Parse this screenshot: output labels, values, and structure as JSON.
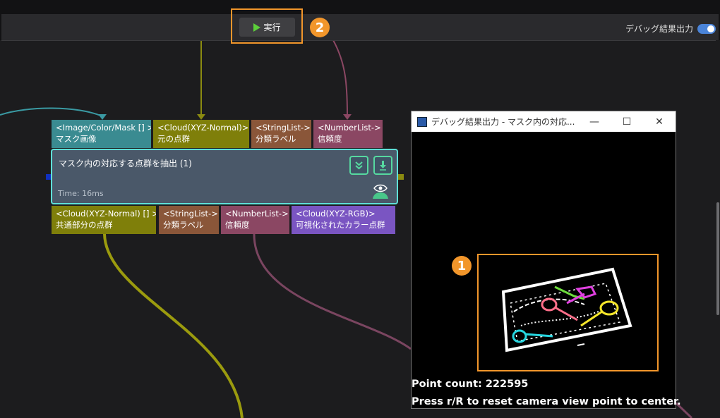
{
  "toolbar": {
    "run_label": "実行",
    "debug_output_label": "デバッグ結果出力",
    "debug_output_enabled": true
  },
  "markers": {
    "one": "1",
    "two": "2"
  },
  "node": {
    "title": "マスク内の対応する点群を抽出 (1)",
    "time": "Time: 16ms",
    "inputs": [
      {
        "type": "<Image/Color/Mask [] >",
        "name": "マスク画像"
      },
      {
        "type": "<Cloud(XYZ-Normal)>",
        "name": "元の点群"
      },
      {
        "type": "<StringList->",
        "name": "分類ラベル"
      },
      {
        "type": "<NumberList->",
        "name": "信頼度"
      }
    ],
    "outputs": [
      {
        "type": "<Cloud(XYZ-Normal) [] >",
        "name": "共通部分の点群"
      },
      {
        "type": "<StringList->",
        "name": "分類ラベル"
      },
      {
        "type": "<NumberList->",
        "name": "信頼度"
      },
      {
        "type": "<Cloud(XYZ-RGB)>",
        "name": "可視化されたカラー点群"
      }
    ]
  },
  "viewer": {
    "title": "デバッグ結果出力 - マスク内の対応...",
    "point_count": "Point count: 222595",
    "hint": "Press r/R to reset camera view point to center."
  },
  "colors": {
    "accent_orange": "#f2962b",
    "node_border": "#5fe0d8",
    "teal": "#3a8b91",
    "olive": "#7f7f0a",
    "brown": "#8a5639",
    "rose": "#8b4763",
    "purple": "#7a55c2"
  }
}
